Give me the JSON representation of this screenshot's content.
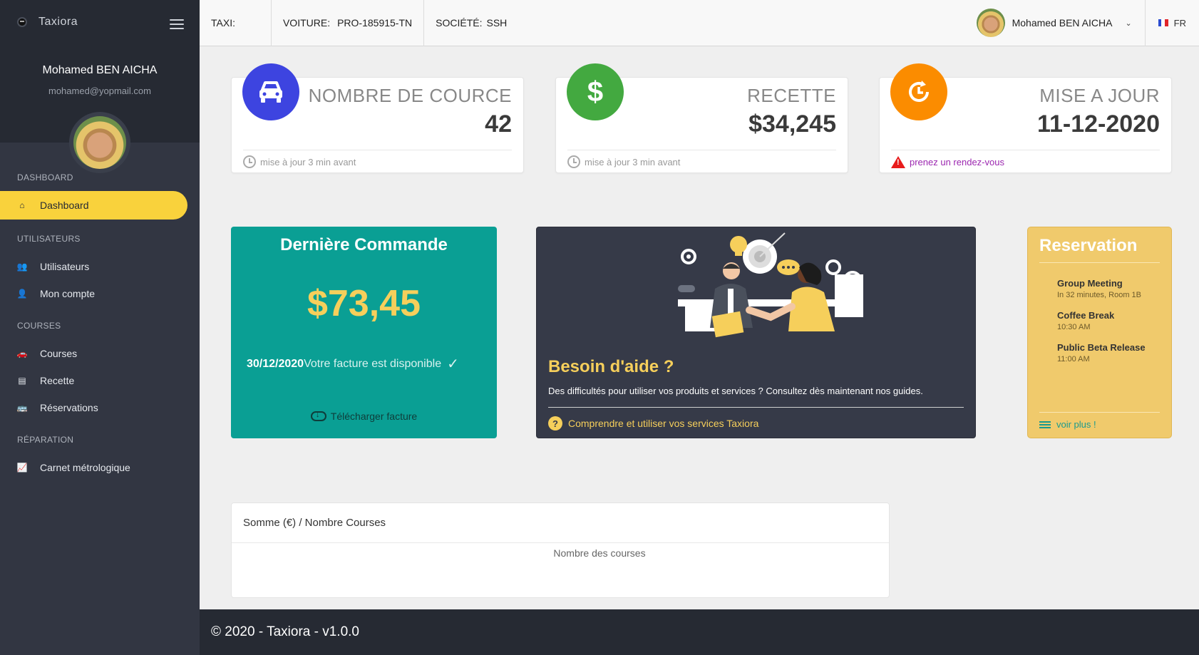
{
  "brand": {
    "name": "Taxiora"
  },
  "sidebar": {
    "user_name": "Mohamed BEN AICHA",
    "user_email": "mohamed@yopmail.com",
    "sections": [
      {
        "title": "DASHBOARD",
        "items": [
          {
            "label": "Dashboard",
            "icon": "home-icon",
            "active": true
          }
        ]
      },
      {
        "title": "UTILISATEURS",
        "items": [
          {
            "label": "Utilisateurs",
            "icon": "users-icon"
          },
          {
            "label": "Mon compte",
            "icon": "user-icon"
          }
        ]
      },
      {
        "title": "COURSES",
        "items": [
          {
            "label": "Courses",
            "icon": "car-icon"
          },
          {
            "label": "Recette",
            "icon": "ledger-icon"
          },
          {
            "label": "Réservations",
            "icon": "bus-icon"
          }
        ]
      },
      {
        "title": "RÉPARATION",
        "items": [
          {
            "label": "Carnet métrologique",
            "icon": "chart-board-icon"
          }
        ]
      }
    ]
  },
  "topbar": {
    "taxi_label": "TAXI:",
    "taxi_value": "",
    "voiture_label": "VOITURE:",
    "voiture_value": "PRO-185915-TN",
    "societe_label": "SOCIÉTÉ:",
    "societe_value": "SSH",
    "user_name": "Mohamed BEN AICHA",
    "lang": "FR"
  },
  "stats": [
    {
      "label": "NOMBRE DE COURCE",
      "value": "42",
      "footer": "mise à jour 3 min avant",
      "color": "#3d44e0",
      "icon": "car-icon"
    },
    {
      "label": "RECETTE",
      "value": "$34,245",
      "footer": "mise à jour 3 min avant",
      "color": "#43a940",
      "icon": "dollar-icon"
    },
    {
      "label": "MISE A JOUR",
      "value": "11-12-2020",
      "footer": "prenez un rendez-vous",
      "color": "#fb8c00",
      "icon": "refresh-clock-icon"
    }
  ],
  "order": {
    "title": "Dernière Commande",
    "amount": "$73,45",
    "date": "30/12/2020",
    "message": "Votre facture est disponible",
    "download": "Télécharger facture"
  },
  "help": {
    "title": "Besoin d'aide ?",
    "description": "Des difficultés pour utiliser vos produits et services ? Consultez dès maintenant nos guides.",
    "link": "Comprendre et utiliser vos services Taxiora"
  },
  "reservation": {
    "title": "Reservation",
    "events": [
      {
        "title": "Group Meeting",
        "sub": "In 32 minutes, Room 1B"
      },
      {
        "title": "Coffee Break",
        "sub": "10:30 AM"
      },
      {
        "title": "Public Beta Release",
        "sub": "11:00 AM"
      }
    ],
    "more": "voir plus !"
  },
  "chart": {
    "title": "Somme (€) / Nombre Courses",
    "legend": "Nombre des courses"
  },
  "footer": {
    "text": "© 2020 - Taxiora - v1.0.0"
  }
}
